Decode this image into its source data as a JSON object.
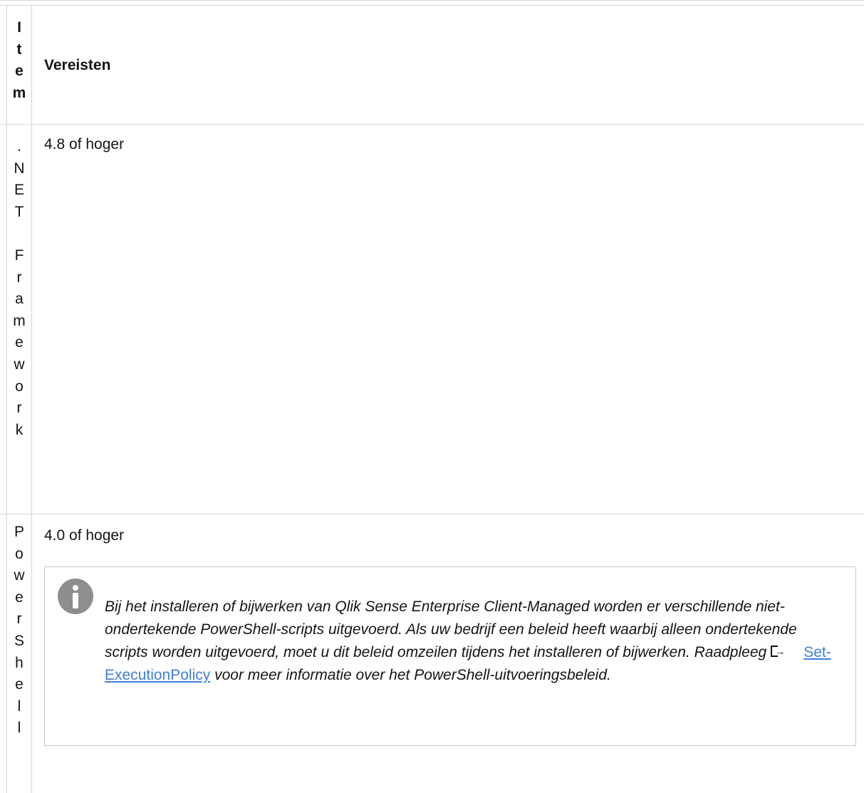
{
  "header": {
    "item_chars": [
      "I",
      "t",
      "e",
      "m"
    ],
    "requirements_label": "Vereisten"
  },
  "rows": [
    {
      "item_chars": [
        ".",
        "N",
        "E",
        "T",
        "",
        "F",
        "r",
        "a",
        "m",
        "e",
        "w",
        "o",
        "r",
        "k"
      ],
      "requirement": "4.8 of hoger"
    },
    {
      "item_chars": [
        "P",
        "o",
        "w",
        "e",
        "r",
        "S",
        "h",
        "e",
        "l",
        "l"
      ],
      "requirement": "4.0 of hoger",
      "note": {
        "icon": "info-icon",
        "text_before": "Bij het installeren of bijwerken van Qlik Sense Enterprise Client-Managed worden er verschillende niet-ondertekende PowerShell-scripts uitgevoerd. Als uw bedrijf een beleid heeft waarbij alleen ondertekende scripts worden uitgevoerd, moet u dit beleid omzeilen tijdens het installeren of bijwerken. Raadpleeg",
        "link_icon": "external-link-icon",
        "link_text": "Set-ExecutionPolicy",
        "text_after": "voor meer informatie over het PowerShell-uitvoeringsbeleid."
      }
    }
  ],
  "colors": {
    "border": "#d6d6d6",
    "link": "#3f7fd8",
    "icon_gray": "#8e8e8e"
  }
}
